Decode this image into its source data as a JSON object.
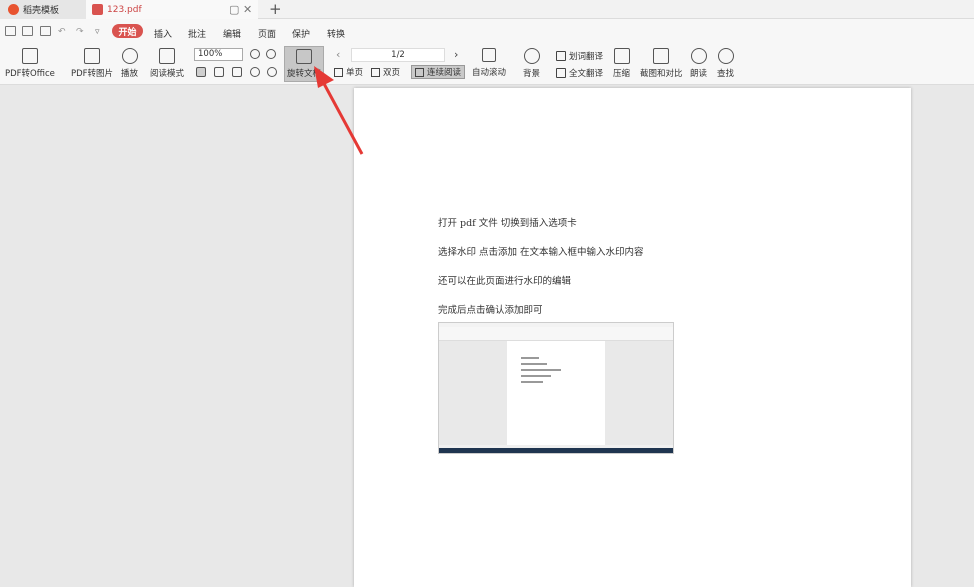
{
  "tabs": [
    {
      "label": "稻壳模板"
    },
    {
      "label": "123.pdf"
    }
  ],
  "menu": {
    "start": "开始",
    "items": [
      "插入",
      "批注",
      "编辑",
      "页面",
      "保护",
      "转换"
    ]
  },
  "ribbon": {
    "pdf_to_office": "PDF转Office",
    "pdf_to_image": "PDF转图片",
    "play": "播放",
    "read_mode": "阅读模式",
    "zoom": "100%",
    "rotate_doc": "旋转文档",
    "page_indicator": "1/2",
    "single_page": "单页",
    "double_page": "双页",
    "continuous_read": "连续阅读",
    "auto_scroll": "自动滚动",
    "background": "背景",
    "word_translate": "划词翻译",
    "full_translate": "全文翻译",
    "compress": "压缩",
    "screenshot_compare": "截图和对比",
    "read_aloud": "朗读",
    "find": "查找"
  },
  "document": {
    "lines": [
      "打开 pdf 文件    切换到插入选项卡",
      "选择水印      点击添加    在文本输入框中输入水印内容",
      "还可以在此页面进行水印的编辑",
      "完成后点击确认添加即可"
    ]
  },
  "colors": {
    "accent": "#d9534f",
    "arrow": "#e53935"
  }
}
